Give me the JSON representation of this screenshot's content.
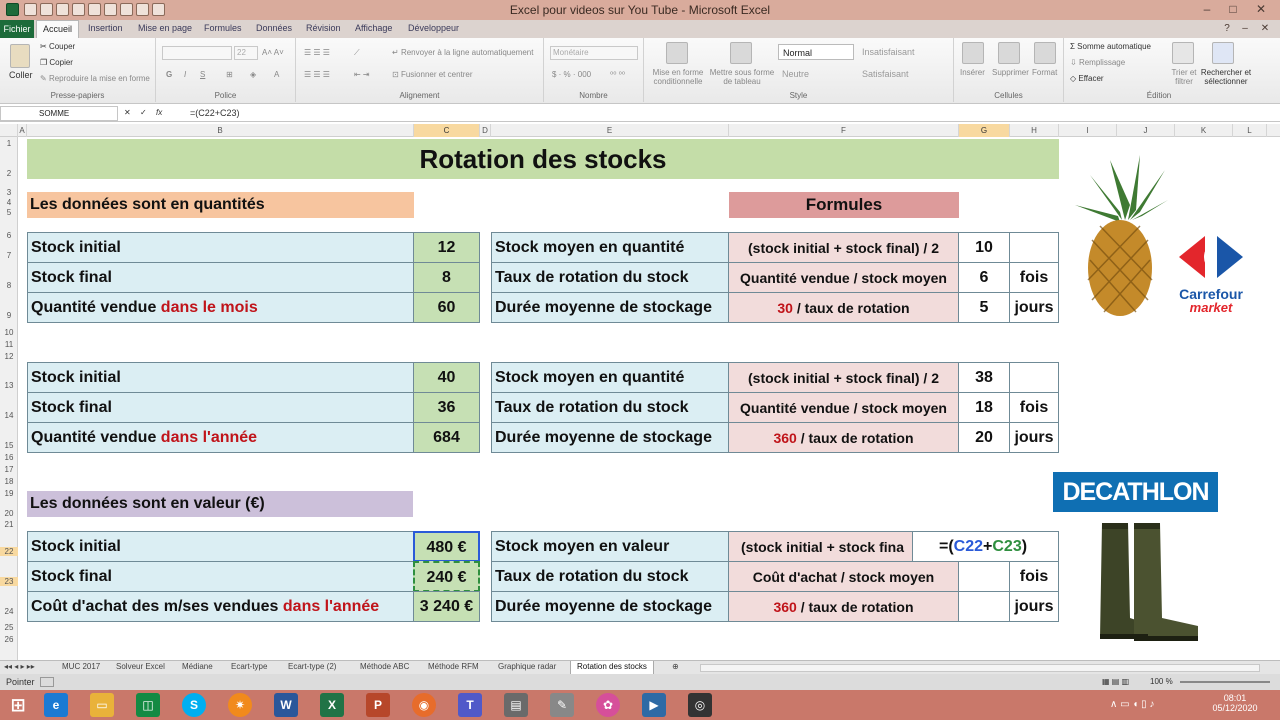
{
  "window": {
    "title": "Excel pour videos sur You Tube - Microsoft Excel"
  },
  "ribbon": {
    "file_tab": "Fichier",
    "tabs": [
      "Accueil",
      "Insertion",
      "Mise en page",
      "Formules",
      "Données",
      "Révision",
      "Affichage",
      "Développeur"
    ],
    "active_tab": "Accueil",
    "clipboard": {
      "paste": "Coller",
      "cut": "Couper",
      "copy": "Copier",
      "format_painter": "Reproduire la mise en forme",
      "label": "Presse-papiers"
    },
    "font": {
      "size": "22",
      "label": "Police"
    },
    "alignment": {
      "wrap": "Renvoyer à la ligne automatiquement",
      "merge": "Fusionner et centrer",
      "label": "Alignement"
    },
    "number": {
      "format": "Monétaire",
      "label": "Nombre"
    },
    "styles": {
      "cond_format": "Mise en forme conditionnelle",
      "table_format": "Mettre sous forme de tableau",
      "normal": "Normal",
      "insatisfaisant": "Insatisfaisant",
      "neutre": "Neutre",
      "satisfaisant": "Satisfaisant",
      "label": "Style"
    },
    "cells": {
      "insert": "Insérer",
      "delete": "Supprimer",
      "format": "Format",
      "label": "Cellules"
    },
    "editing": {
      "autosum": "Somme automatique",
      "fill": "Remplissage",
      "clear": "Effacer",
      "sort": "Trier et filtrer",
      "find": "Rechercher et sélectionner",
      "label": "Édition"
    }
  },
  "formula_bar": {
    "name_box": "SOMME",
    "formula": "=(C22+C23)"
  },
  "columns": [
    "A",
    "B",
    "C",
    "D",
    "E",
    "F",
    "G",
    "H",
    "I",
    "J",
    "K",
    "L"
  ],
  "rows": [
    "1",
    "2",
    "3",
    "4",
    "5",
    "6",
    "7",
    "8",
    "9",
    "10",
    "11",
    "12",
    "13",
    "14",
    "15",
    "16",
    "17",
    "18",
    "19",
    "20",
    "21",
    "22",
    "23",
    "24",
    "25",
    "26"
  ],
  "sheet": {
    "title": "Rotation des stocks",
    "section_qty": "Les données sont en quantités",
    "section_formulas": "Formules",
    "section_value": "Les données sont en valeur (€)",
    "block1": {
      "stock_initial": "Stock initial",
      "stock_initial_val": "12",
      "stock_final": "Stock final",
      "stock_final_val": "8",
      "qty_sold": "Quantité vendue ",
      "qty_sold_red": "dans le mois",
      "qty_sold_val": "60",
      "avg_stock": "Stock moyen en quantité",
      "avg_formula": "(stock initial + stock final) / 2",
      "avg_val": "10",
      "rotation": "Taux de rotation du stock",
      "rotation_formula": "Quantité vendue / stock moyen",
      "rotation_val": "6",
      "rotation_unit": "fois",
      "duration": "Durée moyenne de stockage",
      "duration_formula_red": "30",
      "duration_formula": " / taux de rotation",
      "duration_val": "5",
      "duration_unit": "jours"
    },
    "block2": {
      "stock_initial": "Stock initial",
      "stock_initial_val": "40",
      "stock_final": "Stock final",
      "stock_final_val": "36",
      "qty_sold": "Quantité vendue ",
      "qty_sold_red": "dans l'année",
      "qty_sold_val": "684",
      "avg_stock": "Stock moyen en quantité",
      "avg_formula": "(stock initial + stock final) / 2",
      "avg_val": "38",
      "rotation": "Taux de rotation du stock",
      "rotation_formula": "Quantité vendue / stock moyen",
      "rotation_val": "18",
      "rotation_unit": "fois",
      "duration": "Durée moyenne de stockage",
      "duration_formula_red": "360",
      "duration_formula": " / taux de rotation",
      "duration_val": "20",
      "duration_unit": "jours"
    },
    "block3": {
      "stock_initial": "Stock initial",
      "stock_initial_val": "480 €",
      "stock_final": "Stock final",
      "stock_final_val": "240 €",
      "cost": "Coût d'achat des m/ses vendues ",
      "cost_red": "dans l'année",
      "cost_val": "3 240 €",
      "avg_stock": "Stock moyen en valeur",
      "avg_formula": "(stock initial + stock fina",
      "edit_prefix": "=(",
      "edit_ref1": "C22",
      "edit_plus": "+",
      "edit_ref2": "C23",
      "edit_suffix": ")",
      "rotation": "Taux de rotation du stock",
      "rotation_formula": "Coût d'achat / stock moyen",
      "rotation_unit": "fois",
      "duration": "Durée moyenne de stockage",
      "duration_formula_red": "360",
      "duration_formula": " / taux de rotation",
      "duration_unit": "jours"
    },
    "logos": {
      "carrefour": "Carrefour",
      "carrefour_sub": "market",
      "decathlon": "DECATHLON"
    }
  },
  "sheet_tabs": [
    "MUC 2017",
    "Solveur Excel",
    "Médiane",
    "Ecart-type",
    "Ecart-type (2)",
    "Méthode ABC",
    "Méthode RFM",
    "Graphique radar",
    "Rotation des stocks"
  ],
  "active_sheet": "Rotation des stocks",
  "status": {
    "mode": "Pointer"
  },
  "taskbar": {
    "time": "08:01",
    "date": "05/12/2020"
  },
  "colors": {
    "accent_green": "#1d6b3a",
    "title_green": "#c4dda8",
    "orange": "#f7c59f",
    "rose": "#dd9b9b",
    "purple": "#ccc0da",
    "blue": "#dbeef3",
    "green": "#c6e0b4",
    "pink": "#f2dcdb"
  }
}
